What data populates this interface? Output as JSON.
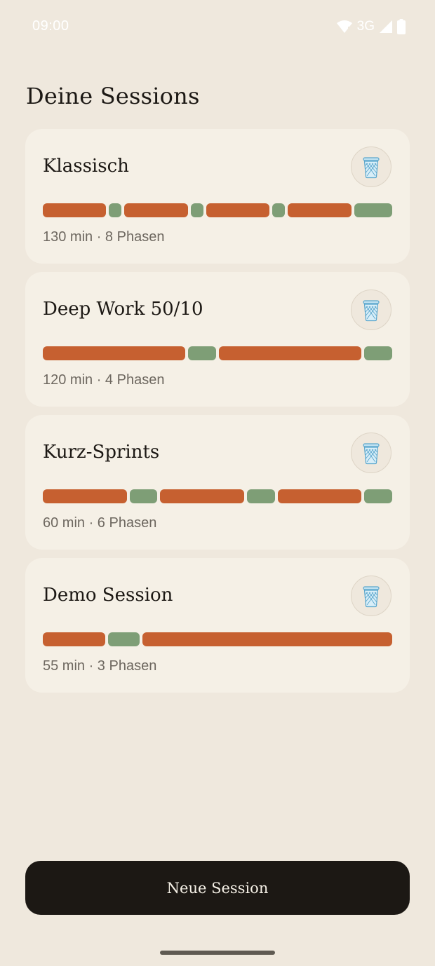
{
  "status_bar": {
    "time": "09:00",
    "network": "3G",
    "icons": [
      "wifi-icon",
      "signal-icon",
      "battery-icon"
    ]
  },
  "header": {
    "title": "Deine Sessions"
  },
  "colors": {
    "focus": "#c66030",
    "break": "#7e9e76",
    "background": "#efe8dd",
    "card": "#f5f0e6",
    "button": "#1c1814"
  },
  "sessions": [
    {
      "name": "Klassisch",
      "meta": "130 min · 8 Phasen",
      "delete_icon": "trash-icon",
      "phases": [
        {
          "type": "focus",
          "minutes": 25
        },
        {
          "type": "break",
          "minutes": 5
        },
        {
          "type": "focus",
          "minutes": 25
        },
        {
          "type": "break",
          "minutes": 5
        },
        {
          "type": "focus",
          "minutes": 25
        },
        {
          "type": "break",
          "minutes": 5
        },
        {
          "type": "focus",
          "minutes": 25
        },
        {
          "type": "break",
          "minutes": 15
        }
      ]
    },
    {
      "name": "Deep Work 50/10",
      "meta": "120 min · 4 Phasen",
      "delete_icon": "trash-icon",
      "phases": [
        {
          "type": "focus",
          "minutes": 50
        },
        {
          "type": "break",
          "minutes": 10
        },
        {
          "type": "focus",
          "minutes": 50
        },
        {
          "type": "break",
          "minutes": 10
        }
      ]
    },
    {
      "name": "Kurz-Sprints",
      "meta": "60 min · 6 Phasen",
      "delete_icon": "trash-icon",
      "phases": [
        {
          "type": "focus",
          "minutes": 15
        },
        {
          "type": "break",
          "minutes": 5
        },
        {
          "type": "focus",
          "minutes": 15
        },
        {
          "type": "break",
          "minutes": 5
        },
        {
          "type": "focus",
          "minutes": 15
        },
        {
          "type": "break",
          "minutes": 5
        }
      ]
    },
    {
      "name": "Demo Session",
      "meta": "55 min · 3 Phasen",
      "delete_icon": "trash-icon",
      "phases": [
        {
          "type": "focus",
          "minutes": 10
        },
        {
          "type": "break",
          "minutes": 5
        },
        {
          "type": "focus",
          "minutes": 40
        }
      ]
    }
  ],
  "actions": {
    "new_session_label": "Neue Session"
  }
}
